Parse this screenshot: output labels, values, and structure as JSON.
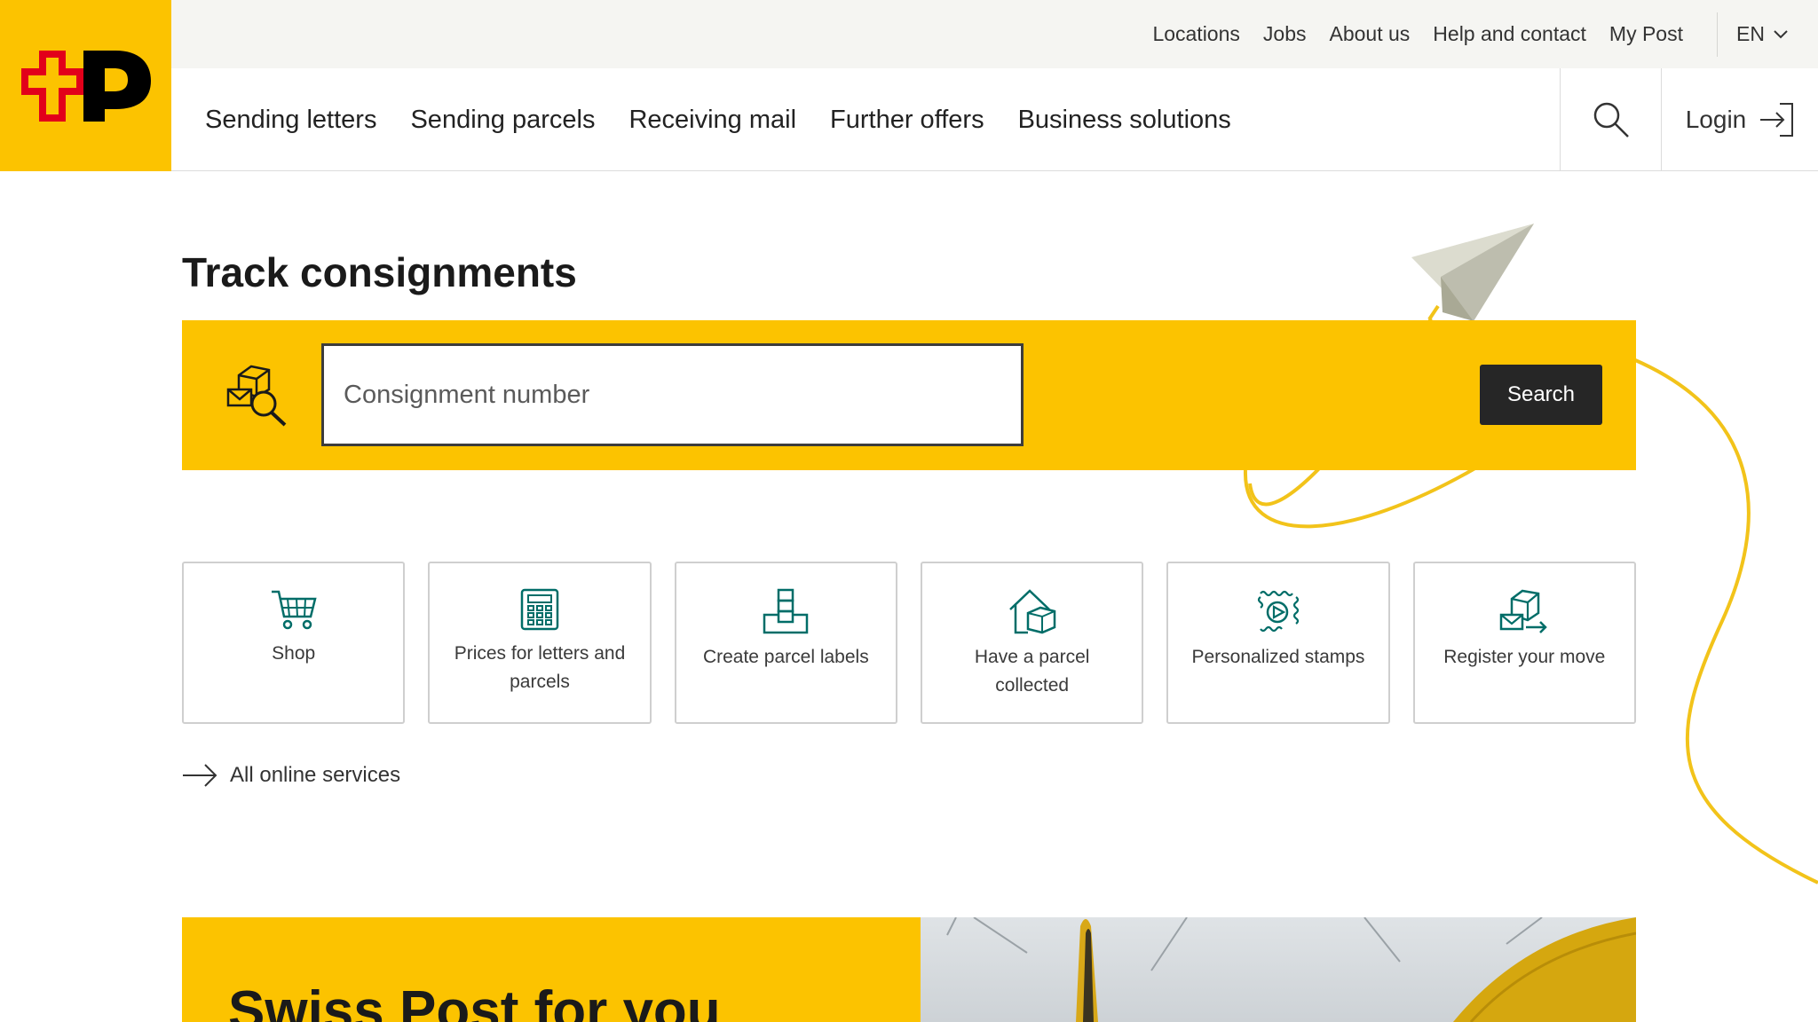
{
  "header": {
    "top_links": [
      "Locations",
      "Jobs",
      "About us",
      "Help and contact",
      "My Post"
    ],
    "language": "EN",
    "nav_items": [
      "Sending letters",
      "Sending parcels",
      "Receiving mail",
      "Further offers",
      "Business solutions"
    ],
    "login_label": "Login"
  },
  "colors": {
    "brand_yellow": "#fcc300",
    "logo_red": "#e2001a",
    "icon_teal": "#006d68",
    "button_dark": "#262626"
  },
  "track": {
    "title": "Track consignments",
    "input_placeholder": "Consignment number",
    "input_value": "",
    "button_label": "Search"
  },
  "tiles": [
    {
      "label": "Shop",
      "icon": "shopping-cart-icon"
    },
    {
      "label": "Prices for letters and parcels",
      "icon": "calculator-icon"
    },
    {
      "label": "Create parcel labels",
      "icon": "parcel-label-icon"
    },
    {
      "label": "Have a parcel collected",
      "icon": "house-parcel-icon"
    },
    {
      "label": "Personalized stamps",
      "icon": "stamp-icon"
    },
    {
      "label": "Register your move",
      "icon": "moving-box-icon"
    }
  ],
  "all_services_label": "All online services",
  "promo": {
    "title": "Swiss Post for you"
  }
}
